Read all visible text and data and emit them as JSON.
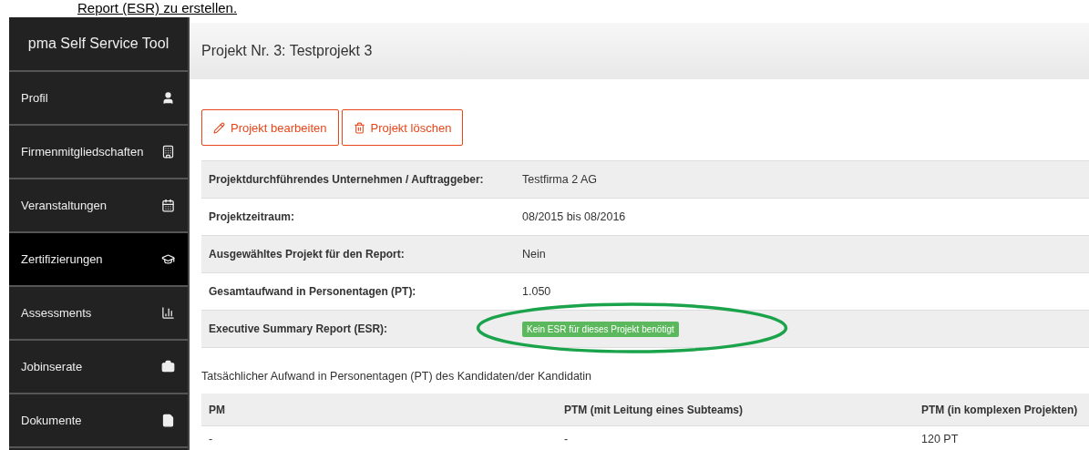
{
  "caption": "Report (ESR) zu erstellen.",
  "sidebar": {
    "brand": "pma Self Service Tool",
    "items": [
      {
        "label": "Profil",
        "selected": false
      },
      {
        "label": "Firmenmitgliedschaften",
        "selected": false
      },
      {
        "label": "Veranstaltungen",
        "selected": false
      },
      {
        "label": "Zertifizierungen",
        "selected": true
      },
      {
        "label": "Assessments",
        "selected": false
      },
      {
        "label": "Jobinserate",
        "selected": false
      },
      {
        "label": "Dokumente",
        "selected": false
      }
    ]
  },
  "page_title": "Projekt Nr. 3: Testprojekt 3",
  "buttons": [
    {
      "label": "Projekt bearbeiten",
      "kind": "edit"
    },
    {
      "label": "Projekt löschen",
      "kind": "delete"
    }
  ],
  "details": [
    {
      "label": "Projektdurchführendes Unternehmen / Auftraggeber:",
      "value": "Testfirma 2 AG",
      "kind": "text"
    },
    {
      "label": "Projektzeitraum:",
      "value": "08/2015 bis 08/2016",
      "kind": "text"
    },
    {
      "label": "Ausgewähltes Projekt für den Report:",
      "value": "Nein",
      "kind": "text"
    },
    {
      "label": "Gesamtaufwand in Personentagen (PT):",
      "value": "1.050",
      "kind": "text"
    },
    {
      "label": "Executive Summary Report (ESR):",
      "value": "Kein ESR für dieses Projekt benötigt",
      "kind": "badge"
    }
  ],
  "effort": {
    "description": "Tatsächlicher Aufwand in Personentagen (PT) des Kandidaten/der Kandidatin",
    "columns": [
      "PM",
      "PTM (mit Leitung eines Subteams)",
      "PTM (in komplexen Projekten)"
    ],
    "rows": [
      [
        "-",
        "-",
        "120 PT"
      ]
    ]
  }
}
